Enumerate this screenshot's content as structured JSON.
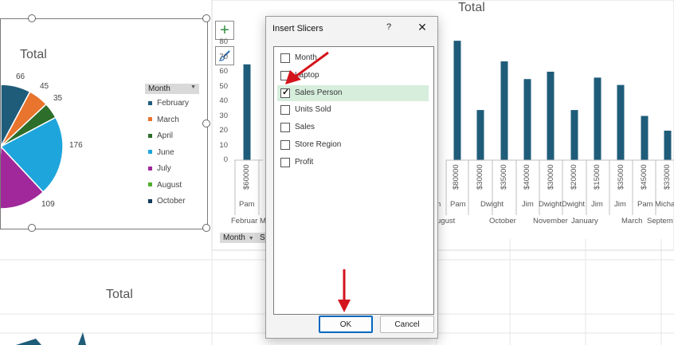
{
  "pie_chart": {
    "title": "Total",
    "labels": [
      "66",
      "45",
      "35",
      "176",
      "109"
    ],
    "legend_button": "Month",
    "legend": [
      {
        "label": "February",
        "color": "#1f5c7a"
      },
      {
        "label": "March",
        "color": "#e8742d"
      },
      {
        "label": "April",
        "color": "#2c6e2a"
      },
      {
        "label": "June",
        "color": "#1ea6dc"
      },
      {
        "label": "July",
        "color": "#a0289a"
      },
      {
        "label": "August",
        "color": "#4fae2e"
      },
      {
        "label": "October",
        "color": "#123a5e"
      }
    ]
  },
  "bar_chart": {
    "title": "Total",
    "yticks": [
      "80",
      "70",
      "60",
      "50",
      "40",
      "30",
      "20",
      "10",
      "0"
    ],
    "field_button": "Month",
    "field_button_2": "Sa",
    "left_categories": [
      {
        "value": "$60000",
        "person": "Pam",
        "month": "Februar"
      },
      {
        "value": "",
        "person": "",
        "month": "M"
      }
    ],
    "right_categories": [
      {
        "value": "$80000",
        "person": "Pam"
      },
      {
        "value": "$30000",
        "person": "Dwight"
      },
      {
        "value": "$35000",
        "person": ""
      },
      {
        "value": "$40000",
        "person": "Jim"
      },
      {
        "value": "$30000",
        "person": "Dwight"
      },
      {
        "value": "$20000",
        "person": "Dwight"
      },
      {
        "value": "$15000",
        "person": "Jim"
      },
      {
        "value": "$35000",
        "person": "Jim"
      },
      {
        "value": "$45000",
        "person": "Pam"
      },
      {
        "value": "$33000",
        "person": "Michae"
      }
    ],
    "months": [
      "ugust",
      "October",
      "November",
      "January",
      "March",
      "Septem"
    ],
    "partial_left": "n"
  },
  "bottom_chart": {
    "title": "Total"
  },
  "dialog": {
    "title": "Insert Slicers",
    "help": "?",
    "close": "✕",
    "options": [
      {
        "label": "Month",
        "checked": false
      },
      {
        "label": "Laptop",
        "checked": false
      },
      {
        "label": "Sales Person",
        "checked": true
      },
      {
        "label": "Units Sold",
        "checked": false
      },
      {
        "label": "Sales",
        "checked": false
      },
      {
        "label": "Store Region",
        "checked": false
      },
      {
        "label": "Profit",
        "checked": false
      }
    ],
    "ok_label": "OK",
    "cancel_label": "Cancel"
  },
  "chart_data": [
    {
      "type": "pie",
      "title": "Total",
      "categories": [
        "February",
        "March",
        "April",
        "June",
        "July",
        "August",
        "October"
      ],
      "values": [
        66,
        45,
        35,
        176,
        109,
        null,
        null
      ]
    },
    {
      "type": "bar",
      "title": "Total",
      "ylim": [
        0,
        80
      ],
      "categories": [
        "Pam $60000",
        "Pam $80000",
        "Dwight $30000",
        "$35000",
        "Jim $40000",
        "Dwight $30000",
        "Dwight $20000",
        "Jim $15000",
        "Jim $35000",
        "Pam $45000",
        "Michae $33000"
      ],
      "values": [
        65,
        81,
        34,
        67,
        55,
        60,
        34,
        56,
        51,
        30,
        20
      ]
    }
  ]
}
